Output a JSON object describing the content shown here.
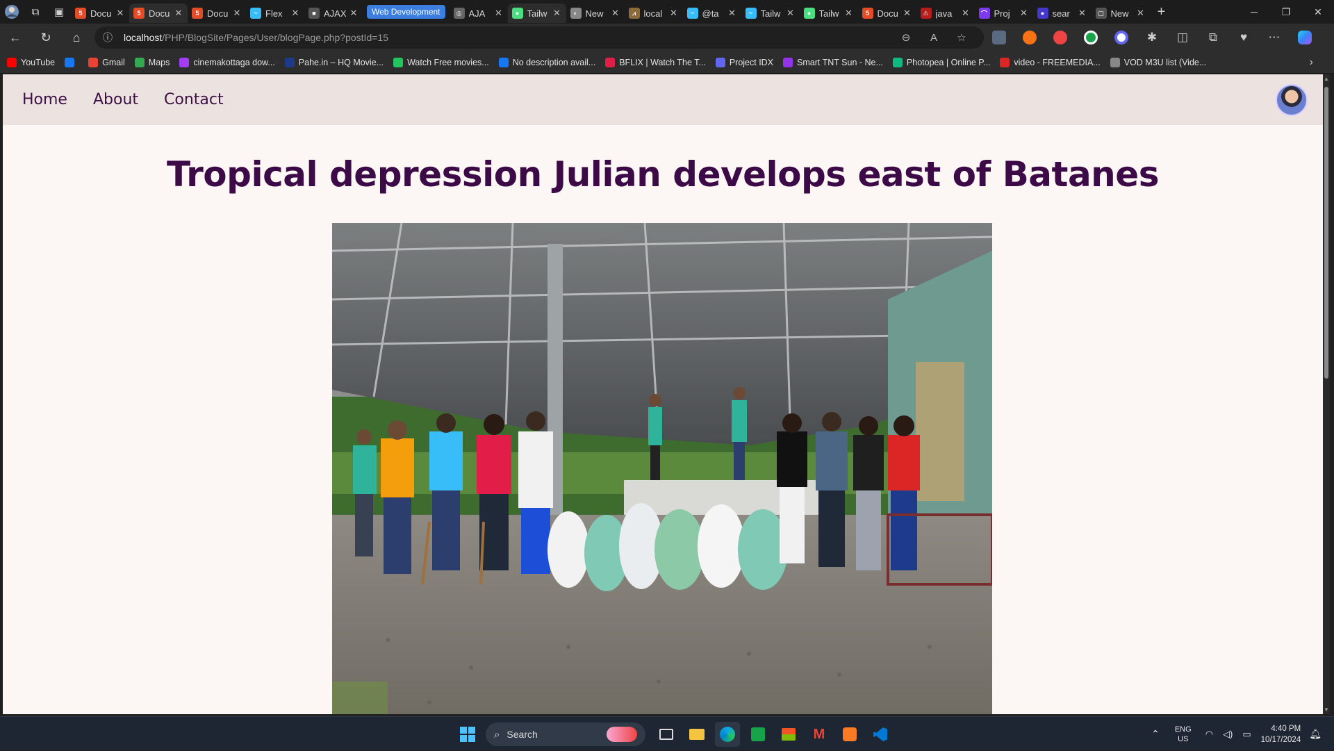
{
  "browser": {
    "tabs": [
      {
        "title": "Docu",
        "fav_color": "#e34c26",
        "fav_text": "5"
      },
      {
        "title": "Docu",
        "fav_color": "#e34c26",
        "fav_text": "5",
        "active": true
      },
      {
        "title": "Docu",
        "fav_color": "#e34c26",
        "fav_text": "5"
      },
      {
        "title": "Flex",
        "fav_color": "#38bdf8",
        "fav_text": "~"
      },
      {
        "title": "AJAX",
        "fav_color": "#555555",
        "fav_text": "■"
      }
    ],
    "group_label": "Web Development",
    "grouped_tabs": [
      {
        "title": "AJA",
        "fav_color": "#666666",
        "fav_text": "◎"
      },
      {
        "title": "Tailw",
        "fav_color": "#4ade80",
        "fav_text": "●",
        "active": true
      },
      {
        "title": "New",
        "fav_color": "#888888",
        "fav_text": "◐"
      },
      {
        "title": "local",
        "fav_color": "#8b6b3a",
        "fav_text": "⩘"
      },
      {
        "title": "@ta",
        "fav_color": "#38bdf8",
        "fav_text": "~"
      },
      {
        "title": "Tailw",
        "fav_color": "#38bdf8",
        "fav_text": "~"
      },
      {
        "title": "Tailw",
        "fav_color": "#4ade80",
        "fav_text": "●"
      },
      {
        "title": "Docu",
        "fav_color": "#e34c26",
        "fav_text": "5"
      },
      {
        "title": "java",
        "fav_color": "#b91c1c",
        "fav_text": "⚠"
      },
      {
        "title": "Proj",
        "fav_color": "#7c3aed",
        "fav_text": "⌒"
      },
      {
        "title": "sear",
        "fav_color": "#4338ca",
        "fav_text": "●"
      },
      {
        "title": "New",
        "fav_color": "#555555",
        "fav_text": "▢"
      }
    ],
    "url_host": "localhost",
    "url_path": "/PHP/BlogSite/Pages/User/blogPage.php?postId=15",
    "bookmarks": [
      {
        "label": "YouTube",
        "color": "#ff0000"
      },
      {
        "label": "",
        "color": "#1877f2"
      },
      {
        "label": "Gmail",
        "color": "#ea4335"
      },
      {
        "label": "Maps",
        "color": "#34a853"
      },
      {
        "label": "cinemakottaga dow...",
        "color": "#a23cf5"
      },
      {
        "label": "Pahe.in – HQ Movie...",
        "color": "#1e3a8a"
      },
      {
        "label": "Watch Free movies...",
        "color": "#22c55e"
      },
      {
        "label": "No description avail...",
        "color": "#1877f2"
      },
      {
        "label": "BFLIX | Watch The T...",
        "color": "#e11d48"
      },
      {
        "label": "Project IDX",
        "color": "#6366f1"
      },
      {
        "label": "Smart TNT Sun - Ne...",
        "color": "#9333ea"
      },
      {
        "label": "Photopea | Online P...",
        "color": "#10b981"
      },
      {
        "label": "video - FREEMEDIA...",
        "color": "#dc2626"
      },
      {
        "label": "VOD M3U list (Vide...",
        "color": "#888888"
      }
    ]
  },
  "site": {
    "nav": {
      "home": "Home",
      "about": "About",
      "contact": "Contact"
    },
    "post_title": "Tropical depression Julian develops east of Batanes"
  },
  "taskbar": {
    "search_placeholder": "Search",
    "lang_line1": "ENG",
    "lang_line2": "US",
    "time": "4:40 PM",
    "date": "10/17/2024"
  }
}
